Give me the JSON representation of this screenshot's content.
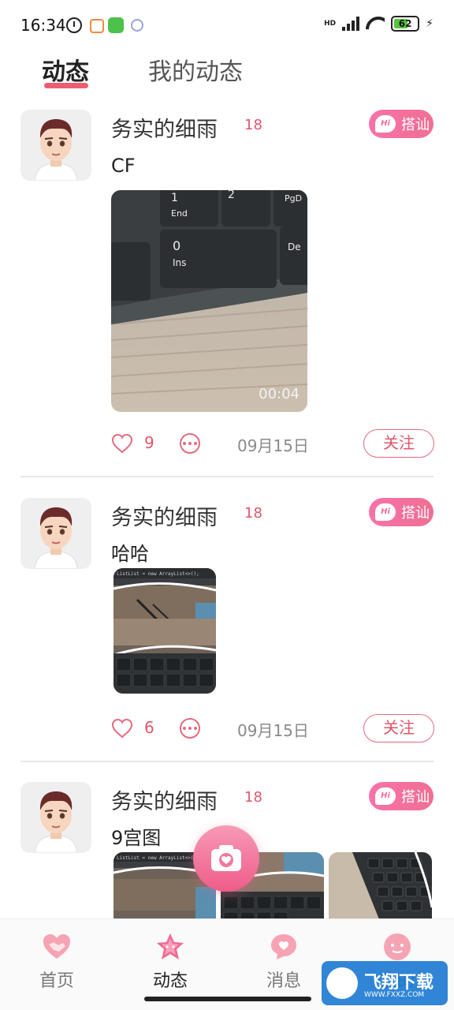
{
  "status_bar": {
    "time": "16:34",
    "network_label": "HD",
    "network_type": "4G",
    "battery_percent": 62,
    "battery_text": "62"
  },
  "tabs": [
    {
      "label": "动态",
      "active": true
    },
    {
      "label": "我的动态",
      "active": false
    }
  ],
  "posts": [
    {
      "username": "务实的细雨",
      "age": "18",
      "hi_label": "搭讪",
      "hi_badge": "Hi",
      "text": "CF",
      "media_type": "video",
      "video_duration": "00:04",
      "likes": "9",
      "date": "09月15日",
      "follow_label": "关注"
    },
    {
      "username": "务实的细雨",
      "age": "18",
      "hi_label": "搭讪",
      "hi_badge": "Hi",
      "text": "哈哈",
      "media_type": "image",
      "code_line": "ListList = new ArrayList<>();",
      "likes": "6",
      "date": "09月15日",
      "follow_label": "关注"
    },
    {
      "username": "务实的细雨",
      "age": "18",
      "hi_label": "搭讪",
      "hi_badge": "Hi",
      "text": "9宫图",
      "media_type": "grid",
      "code_line": "ListList = new ArrayList<>();"
    }
  ],
  "bottom_nav": [
    {
      "label": "首页",
      "icon": "handshake-icon",
      "active": false
    },
    {
      "label": "动态",
      "icon": "star-icon",
      "active": true
    },
    {
      "label": "消息",
      "icon": "message-heart-icon",
      "active": false
    },
    {
      "label": "我的",
      "icon": "profile-face-icon",
      "active": false
    }
  ],
  "watermark": {
    "title": "飞翔下载",
    "subtitle": "WWW.FXXZ.COM"
  },
  "colors": {
    "accent": "#ec5d72",
    "hi_gradient_start": "#f772a9",
    "hi_gradient_end": "#ef6f93",
    "fab_bottom": "#ee5c89"
  }
}
